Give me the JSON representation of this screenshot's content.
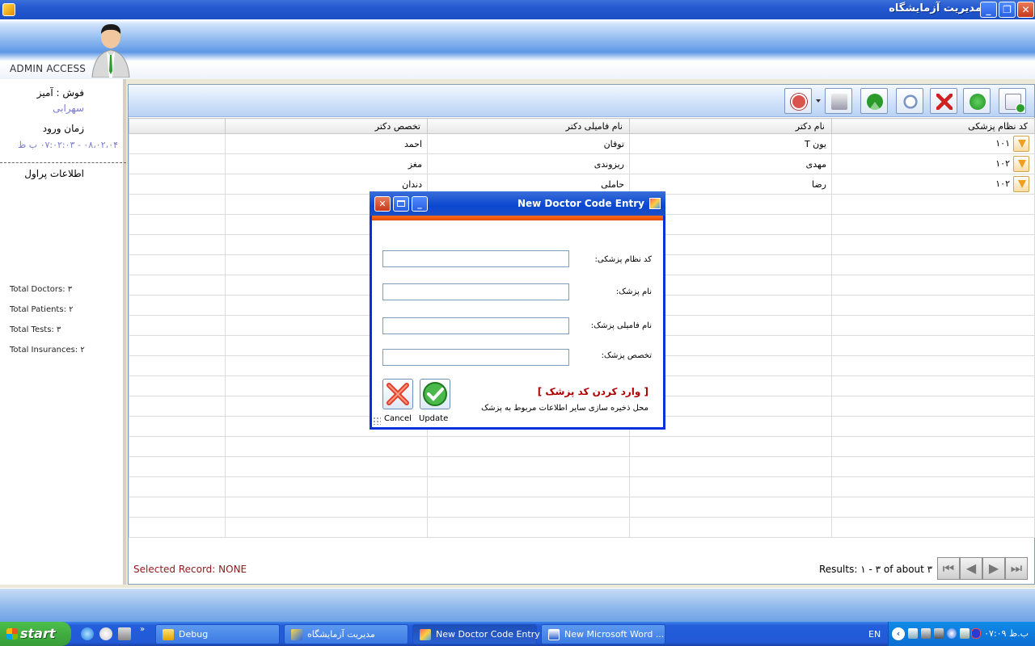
{
  "window": {
    "title": "مدیریت آزمایشگاه",
    "minimize_glyph": "_",
    "restore_glyph": "❐",
    "close_glyph": "✕"
  },
  "header": {
    "admin_label": "ADMIN ACCESS"
  },
  "left_panel": {
    "user_label": "فوش : آمیز",
    "user_name": "سهرابی",
    "login_time_label": "زمان ورود",
    "login_time_value": "۰۸،۰۲،۰۴ - ۰۷:۰۲:۰۳ ب ظ",
    "section_title": "اطلاعات پراول",
    "stats": {
      "doctors": "Total Doctors: ۳",
      "patients": "Total Patients: ۲",
      "tests": "Total Tests: ۳",
      "insurances": "Total Insurances: ۲"
    }
  },
  "toolbar": {
    "icons": [
      "power-icon",
      "print-icon",
      "refresh-icon",
      "search-icon",
      "delete-icon",
      "down-arrow-icon",
      "add-document-icon"
    ]
  },
  "grid": {
    "columns": [
      "کد نظام پزشکی",
      "نام دکتر",
      "نام فامیلی دکتر",
      "تخصص دکتر",
      ""
    ],
    "rows": [
      {
        "code": "۱۰۱",
        "first_name": "یون T",
        "last_name": "توفان",
        "specialty": "احمد"
      },
      {
        "code": "۱۰۲",
        "first_name": "مهدی",
        "last_name": "ریزوندی",
        "specialty": "مغز"
      },
      {
        "code": "۱۰۲",
        "first_name": "رضا",
        "last_name": "حاملی",
        "specialty": "دندان"
      }
    ],
    "empty_rows": 17
  },
  "footer": {
    "selected_record": "Selected Record: NONE",
    "results": "Results: ۱ - ۳ of about ۳"
  },
  "dialog": {
    "title": "New Doctor Code Entry",
    "fields": {
      "code_label": "کد نظام پزشکی:",
      "first_name_label": "نام پزشک:",
      "last_name_label": "نام فامیلی پزشک:",
      "specialty_label": "تخصص پزشک:"
    },
    "values": {
      "code": "",
      "first_name": "",
      "last_name": "",
      "specialty": ""
    },
    "heading": "[ وارد کردن کد پزشک ]",
    "description": "محل ذخیره سازی سایر اطلاعات مربوط به پزشک",
    "cancel_label": "Cancel",
    "update_label": "Update"
  },
  "taskbar": {
    "start_label": "start",
    "items": [
      {
        "label": "Debug",
        "active": false
      },
      {
        "label": "مدیریت آزمایشگاه",
        "active": false
      },
      {
        "label": "New Doctor Code Entry",
        "active": true
      },
      {
        "label": "New Microsoft Word ...",
        "active": false
      }
    ],
    "language": "EN",
    "clock": "ب.ظ ۰۷:۰۹"
  },
  "colors": {
    "xp_blue": "#245EDB",
    "start_green": "#379C37",
    "dialog_stripe": "#E24C00",
    "heading_red": "#B00000",
    "selected_record_red": "#8B1A1A"
  }
}
